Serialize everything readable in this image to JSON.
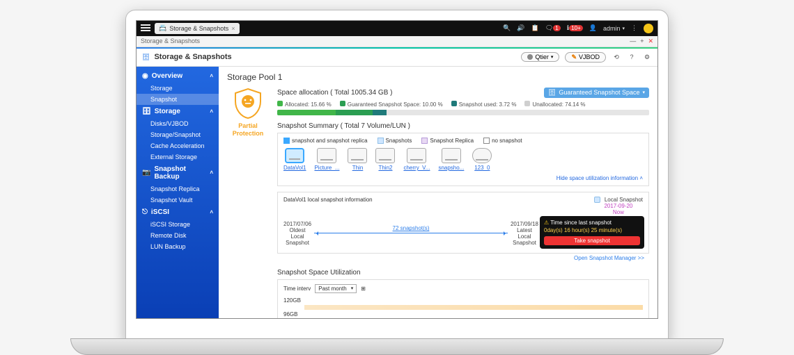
{
  "top": {
    "tab_label": "Storage & Snapshots",
    "admin": "admin"
  },
  "breadcrumb": "Storage & Snapshots",
  "module_title": "Storage & Snapshots",
  "buttons": {
    "qtier": "Qtier",
    "vjbod": "VJBOD"
  },
  "sidebar": {
    "groups": [
      {
        "label": "Overview",
        "items": [
          "Storage",
          "Snapshot"
        ],
        "active": "Snapshot"
      },
      {
        "label": "Storage",
        "items": [
          "Disks/VJBOD",
          "Storage/Snapshot",
          "Cache Acceleration",
          "External Storage"
        ]
      },
      {
        "label": "Snapshot Backup",
        "items": [
          "Snapshot Replica",
          "Snapshot Vault"
        ]
      },
      {
        "label": "iSCSI",
        "items": [
          "iSCSI Storage",
          "Remote Disk",
          "LUN Backup"
        ]
      }
    ]
  },
  "pool_title": "Storage Pool 1",
  "protection": {
    "label1": "Partial",
    "label2": "Protection"
  },
  "allocation": {
    "title": "Space allocation ( Total 1005.34 GB )",
    "snapshot_space_btn": "Guaranteed Snapshot Space",
    "legend": [
      {
        "color": "#41b649",
        "text": "Allocated: 15.66 %"
      },
      {
        "color": "#2b9e52",
        "text": "Guaranteed Snapshot Space: 10.00 %"
      },
      {
        "color": "#1f7a7a",
        "text": "Snapshot used: 3.72 %"
      },
      {
        "color": "#cfcfcf",
        "text": "Unallocated: 74.14 %"
      }
    ],
    "segments": [
      15.66,
      10.0,
      3.72
    ]
  },
  "summary": {
    "title": "Snapshot Summary ( Total 7 Volume/LUN )",
    "filters": [
      "snapshot and snapshot replica",
      "Snapshots",
      "Snapshot Replica",
      "no snapshot"
    ],
    "volumes": [
      "DataVol1",
      "Picture_...",
      "Thin",
      "Thin2",
      "cherry_V...",
      "snapsho...",
      "123_0"
    ],
    "hide_link": "Hide space utilization information"
  },
  "timeline": {
    "vol_title": "DataVol1 local snapshot information",
    "local_chip": "Local Snapshot",
    "oldest": {
      "date": "2017/07/06",
      "l1": "Oldest",
      "l2": "Local",
      "l3": "Snapshot"
    },
    "latest": {
      "date": "2017/09/18",
      "l1": "Latest",
      "l2": "Local",
      "l3": "Snapshot"
    },
    "now": {
      "date": "2017-09-20",
      "label": "Now"
    },
    "count": "72 snapshot(s)",
    "tooltip": {
      "title": "Time since last snapshot",
      "time": "0day(s) 16 hour(s) 25 minute(s)",
      "btn": "Take snapshot"
    },
    "open_mgr": "Open Snapshot Manager >>"
  },
  "utilization": {
    "title": "Snapshot Space Utilization",
    "interval_label": "Time interv",
    "interval_value": "Past month",
    "rows": [
      "120GB",
      "96GB"
    ]
  }
}
